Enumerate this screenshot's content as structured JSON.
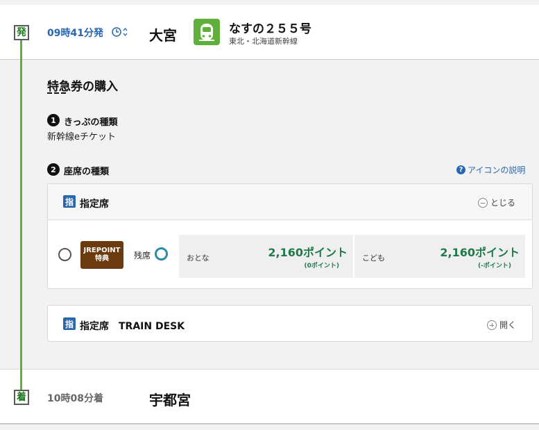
{
  "departure": {
    "marker": "発",
    "time": "09時41分発",
    "station": "大宮",
    "train_name": "なすの２５５号",
    "train_line": "東北・北海道新幹線",
    "icons": [
      "clock-icon",
      "sort-icon",
      "train-icon"
    ]
  },
  "purchase": {
    "title": "特急券の購入",
    "step1": {
      "number": "1",
      "label": "きっぷの種類",
      "value": "新幹線eチケット"
    },
    "step2": {
      "number": "2",
      "label": "座席の種類"
    },
    "icon_help": "アイコンの説明"
  },
  "seat_panels": [
    {
      "badge": "指",
      "label": "指定席",
      "toggle_label": "とじる",
      "expanded": true,
      "row": {
        "selected": false,
        "promo_line1": "JREPOINT",
        "promo_line2": "特典",
        "remaining_label": "残席",
        "remaining_status": "available",
        "adult": {
          "label": "おとな",
          "price": "2,160ポイント",
          "sub": "(0ポイント)"
        },
        "child": {
          "label": "こども",
          "price": "2,160ポイント",
          "sub": "(-ポイント)"
        }
      }
    },
    {
      "badge": "指",
      "label": "指定席　TRAIN DESK",
      "toggle_label": "開く",
      "expanded": false
    }
  ],
  "arrival": {
    "marker": "着",
    "time": "10時08分着",
    "station": "宇都宮"
  },
  "colors": {
    "route_line": "#5fb03a",
    "link_blue": "#2866b0",
    "price_green": "#1e7a4a",
    "promo_brown": "#6b3b0f",
    "remain_teal": "#2b8aa8"
  }
}
